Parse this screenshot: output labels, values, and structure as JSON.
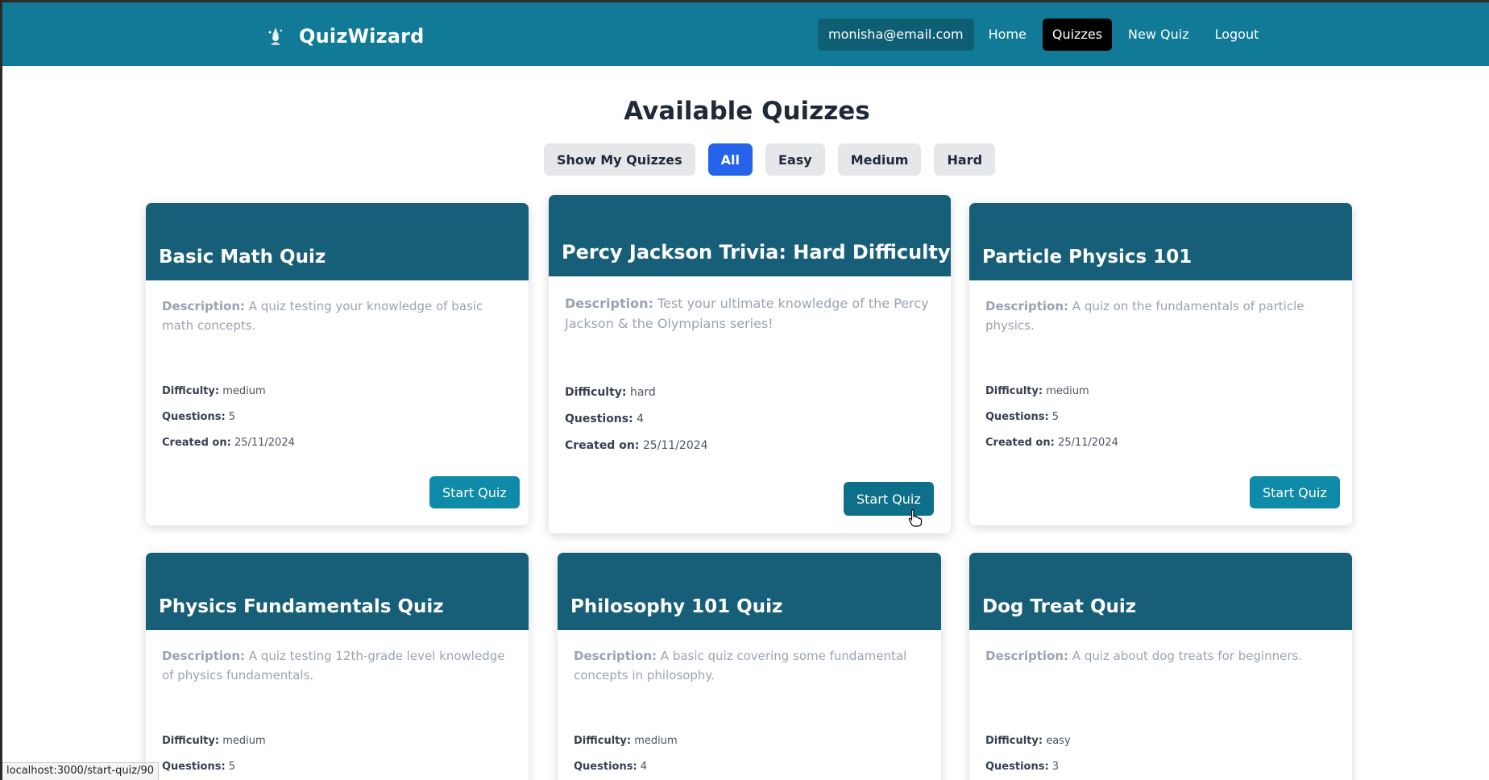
{
  "nav": {
    "brand": "QuizWizard",
    "brand_icon": "wizard-icon",
    "email": "monisha@email.com",
    "links": [
      "Home",
      "Quizzes",
      "New Quiz",
      "Logout"
    ],
    "active": "Quizzes"
  },
  "page": {
    "title": "Available Quizzes",
    "filters": [
      "Show My Quizzes",
      "All",
      "Easy",
      "Medium",
      "Hard"
    ],
    "active_filter": "All"
  },
  "labels": {
    "description": "Description:",
    "difficulty": "Difficulty:",
    "questions": "Questions:",
    "created": "Created on:",
    "start": "Start Quiz"
  },
  "quizzes": [
    {
      "title": "Basic Math Quiz",
      "description": "A quiz testing your knowledge of basic math concepts.",
      "difficulty": "medium",
      "questions": "5",
      "created": "25/11/2024"
    },
    {
      "title": "Percy Jackson Trivia: Hard Difficulty",
      "description": "Test your ultimate knowledge of the Percy Jackson & the Olympians series!",
      "difficulty": "hard",
      "questions": "4",
      "created": "25/11/2024"
    },
    {
      "title": "Particle Physics 101",
      "description": "A quiz on the fundamentals of particle physics.",
      "difficulty": "medium",
      "questions": "5",
      "created": "25/11/2024"
    },
    {
      "title": "Physics Fundamentals Quiz",
      "description": "A quiz testing 12th-grade level knowledge of physics fundamentals.",
      "difficulty": "medium",
      "questions": "5"
    },
    {
      "title": "Philosophy 101 Quiz",
      "description": "A basic quiz covering some fundamental concepts in philosophy.",
      "difficulty": "medium",
      "questions": "4"
    },
    {
      "title": "Dog Treat Quiz",
      "description": "A quiz about dog treats for beginners.",
      "difficulty": "easy",
      "questions": "3"
    }
  ],
  "status_url": "localhost:3000/start-quiz/90",
  "colors": {
    "nav": "#117a96",
    "card_header": "#175f78",
    "button": "#0f8aa8",
    "active_filter": "#2563eb"
  }
}
